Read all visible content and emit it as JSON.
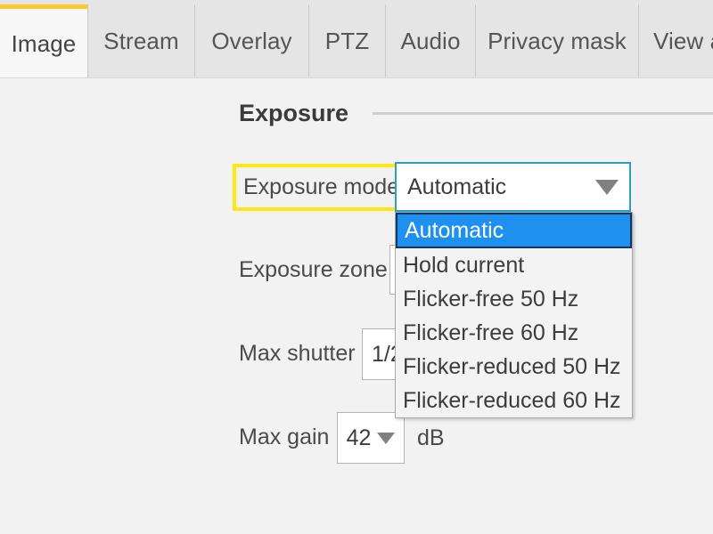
{
  "tabs": [
    {
      "label": "Image",
      "active": true
    },
    {
      "label": "Stream",
      "active": false
    },
    {
      "label": "Overlay",
      "active": false
    },
    {
      "label": "PTZ",
      "active": false
    },
    {
      "label": "Audio",
      "active": false
    },
    {
      "label": "Privacy mask",
      "active": false
    },
    {
      "label": "View a",
      "active": false
    }
  ],
  "section": {
    "title": "Exposure"
  },
  "rows": {
    "exposure_mode": {
      "label": "Exposure mode",
      "value": "Automatic",
      "caret_icon": "chevron-down-icon",
      "highlighted": true
    },
    "exposure_zone": {
      "label": "Exposure zone",
      "value": ""
    },
    "max_shutter": {
      "label": "Max shutter",
      "value": "1/2"
    },
    "max_gain": {
      "label": "Max gain",
      "value": "42",
      "unit": "dB",
      "caret_icon": "chevron-down-icon"
    }
  },
  "dropdown": {
    "open": true,
    "selected_index": 0,
    "options": [
      "Automatic",
      "Hold current",
      "Flicker-free 50 Hz",
      "Flicker-free 60 Hz",
      "Flicker-reduced 50 Hz",
      "Flicker-reduced 60 Hz"
    ]
  },
  "colors": {
    "accent_yellow": "#ffc72c",
    "highlight_yellow": "#ffe713",
    "select_border_teal": "#2b9ec4",
    "selection_blue": "#1e90f0",
    "page_background": "#f2f2f2",
    "tabbar_background": "#e5e5e5"
  }
}
